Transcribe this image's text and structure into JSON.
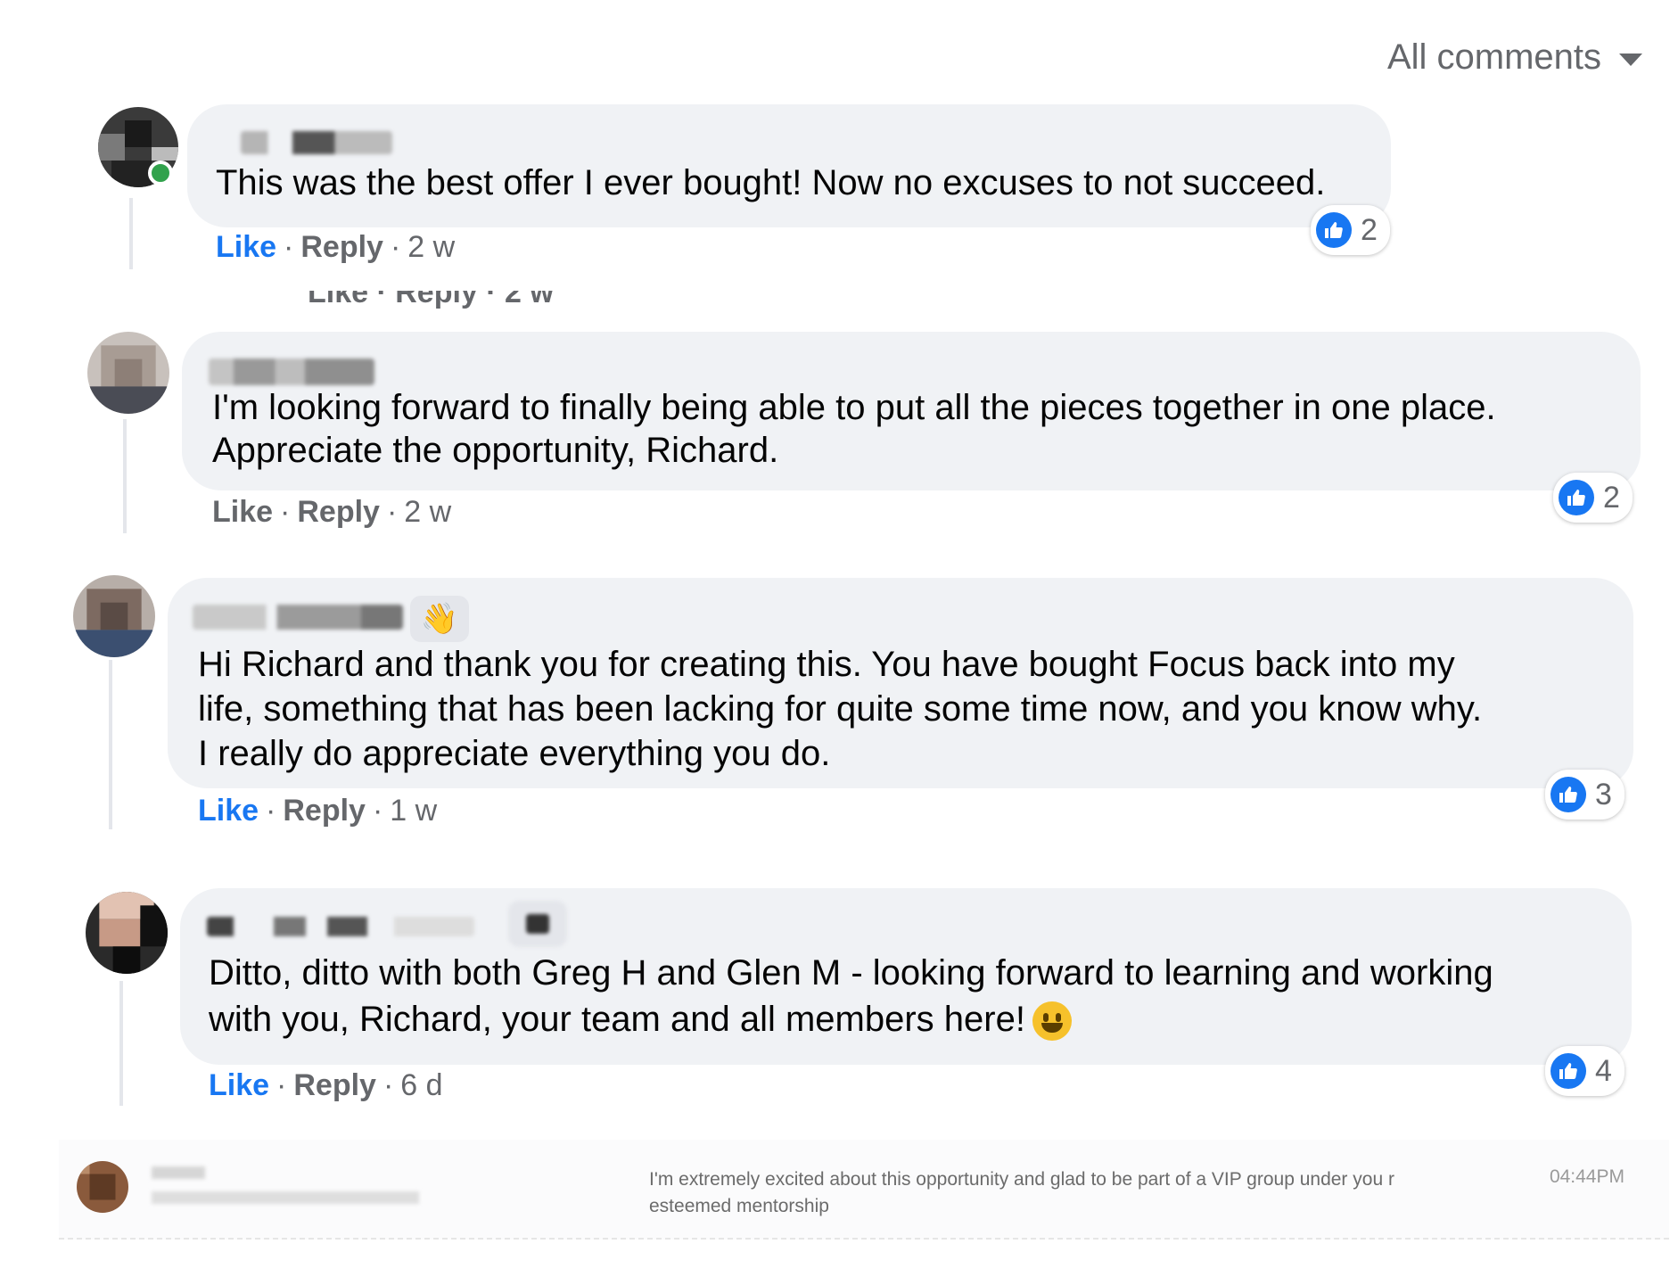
{
  "header": {
    "sort_label": "All comments",
    "sort_icon": "caret-down-icon"
  },
  "comments": [
    {
      "text": "This was the best offer I ever bought! Now no excuses to not succeed.",
      "like_label": "Like",
      "reply_label": "Reply",
      "time": "2 w",
      "reaction_count": "2",
      "reaction_icon": "thumbs-up-icon",
      "like_active": true
    },
    {
      "text_line1": "I'm looking forward to finally being able to put all the pieces together in one place.",
      "text_line2": "Appreciate the opportunity, Richard.",
      "like_label": "Like",
      "reply_label": "Reply",
      "time": "2 w",
      "reaction_count": "2",
      "reaction_icon": "thumbs-up-icon",
      "like_active": false
    },
    {
      "text_line1": "Hi Richard and thank you for creating this. You have bought Focus back into my",
      "text_line2": "life, something that has been lacking for quite some time now, and you know why.",
      "text_line3": "I really do appreciate everything you do.",
      "like_label": "Like",
      "reply_label": "Reply",
      "time": "1 w",
      "reaction_count": "3",
      "reaction_icon": "thumbs-up-icon",
      "like_active": true
    },
    {
      "text_line1": "Ditto, ditto with both Greg H and Glen M - looking forward to learning and working",
      "text_line2": "with you, Richard, your team and all members here!",
      "like_label": "Like",
      "reply_label": "Reply",
      "time": "6 d",
      "reaction_count": "4",
      "reaction_icon": "thumbs-up-icon",
      "like_active": true
    }
  ],
  "message_row": {
    "text": "I'm extremely excited about this opportunity and glad to be part of a VIP group under you r esteemed mentorship",
    "time": "04:44PM"
  },
  "colors": {
    "accent": "#1877f2",
    "bubble": "#f0f2f5",
    "muted": "#65676b",
    "online": "#31a24c"
  }
}
